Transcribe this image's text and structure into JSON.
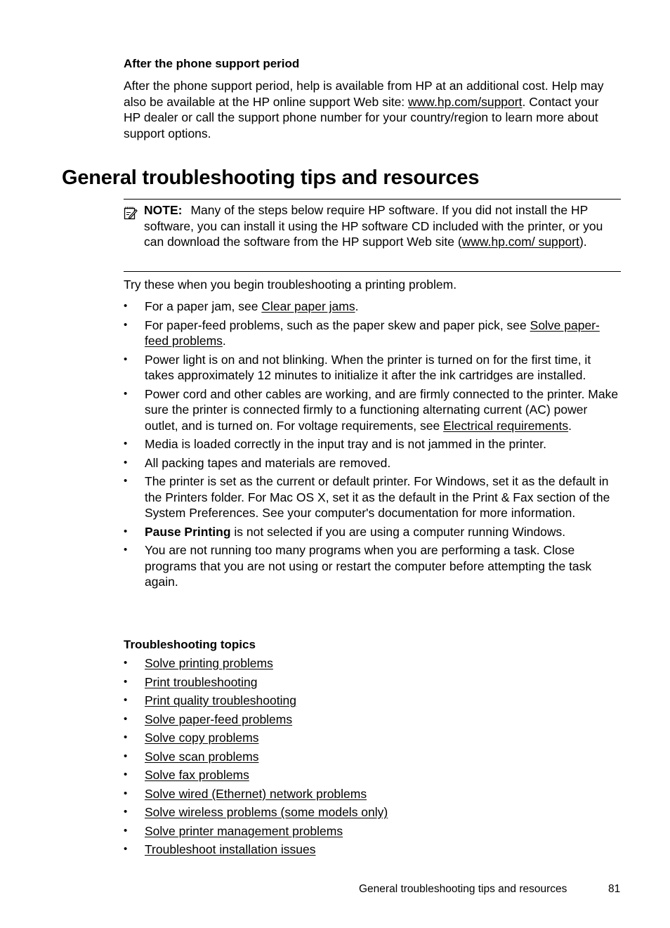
{
  "section_heading": "After the phone support period",
  "section_paragraph": {
    "before_link": "After the phone support period, help is available from HP at an additional cost. Help may also be available at the HP online support Web site: ",
    "link": "www.hp.com/support",
    "after_link": ". Contact your HP dealer or call the support phone number for your country/region to learn more about support options."
  },
  "main_heading": "General troubleshooting tips and resources",
  "note": {
    "icon": "note-pencil-icon",
    "label": "NOTE:",
    "before_link": "Many of the steps below require HP software. If you did not install the HP software, you can install it using the HP software CD included with the printer, or you can download the software from the HP support Web site (",
    "link": "www.hp.com/ support",
    "after_link": ")."
  },
  "intro": "Try these when you begin troubleshooting a printing problem.",
  "tips": [
    {
      "before": "For a paper jam, see ",
      "link": "Clear paper jams",
      "after": "."
    },
    {
      "before": "For paper-feed problems, such as the paper skew and paper pick, see ",
      "link": "Solve paper-feed problems",
      "after": "."
    },
    {
      "before": "Power light is on and not blinking. When the printer is turned on for the first time, it takes approximately 12 minutes to initialize it after the ink cartridges are installed.",
      "link": "",
      "after": ""
    },
    {
      "before": "Power cord and other cables are working, and are firmly connected to the printer. Make sure the printer is connected firmly to a functioning alternating current (AC) power outlet, and is turned on. For voltage requirements, see ",
      "link": "Electrical requirements",
      "after": "."
    },
    {
      "before": "Media is loaded correctly in the input tray and is not jammed in the printer.",
      "link": "",
      "after": ""
    },
    {
      "before": "All packing tapes and materials are removed.",
      "link": "",
      "after": ""
    },
    {
      "before": "The printer is set as the current or default printer. For Windows, set it as the default in the Printers folder. For Mac OS X, set it as the default in the Print & Fax section of the System Preferences. See your computer's documentation for more information.",
      "link": "",
      "after": ""
    },
    {
      "bold": "Pause Printing",
      "before": " is not selected if you are using a computer running Windows.",
      "link": "",
      "after": ""
    },
    {
      "before": "You are not running too many programs when you are performing a task. Close programs that you are not using or restart the computer before attempting the task again.",
      "link": "",
      "after": ""
    }
  ],
  "topics_heading": "Troubleshooting topics",
  "topics": [
    "Solve printing problems",
    "Print troubleshooting",
    "Print quality troubleshooting",
    "Solve paper-feed problems",
    "Solve copy problems",
    "Solve scan problems",
    "Solve fax problems",
    "Solve wired (Ethernet) network problems",
    "Solve wireless problems (some models only)",
    "Solve printer management problems",
    "Troubleshoot installation issues"
  ],
  "footer": {
    "title": "General troubleshooting tips and resources",
    "page_number": "81"
  }
}
